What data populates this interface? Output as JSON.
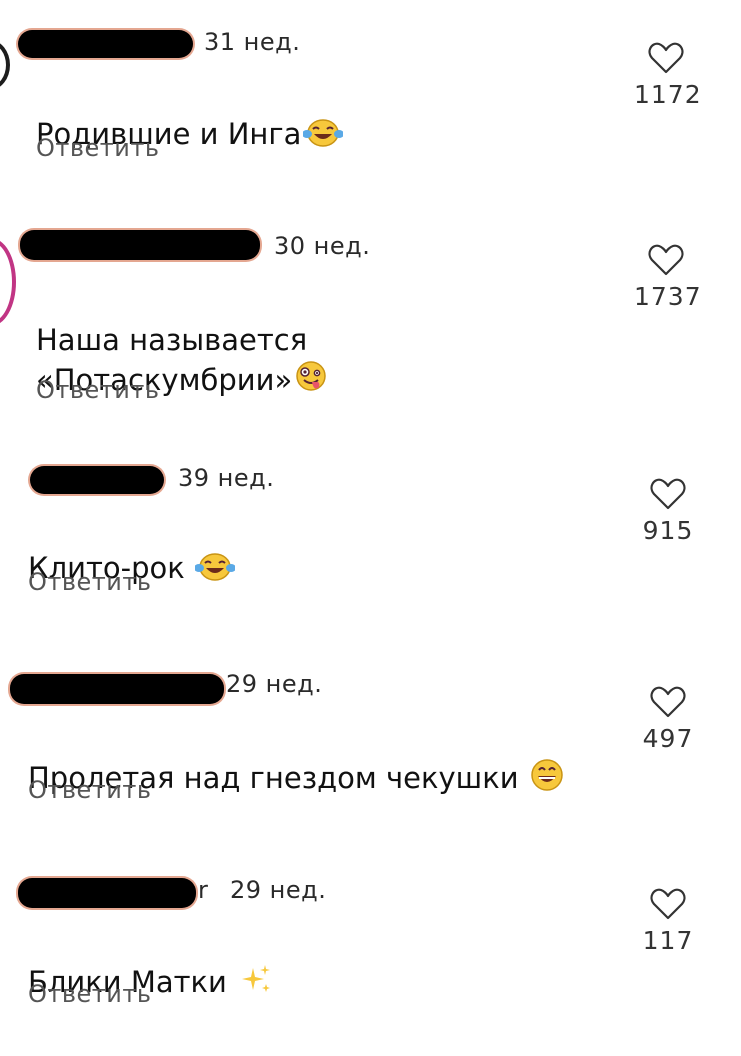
{
  "comments": [
    {
      "time": "31 нед.",
      "text": "Родившие и Инга",
      "emoji": "tears-of-joy-emoji",
      "reply": "Ответить",
      "likes": "1172"
    },
    {
      "time": "30 нед.",
      "text": "Наша называется\n«Потаскумбрии»",
      "emoji": "zany-face-emoji",
      "reply": "Ответить",
      "likes": "1737"
    },
    {
      "time": "39 нед.",
      "text": "Клито-рок",
      "emoji": "tears-of-joy-emoji",
      "reply": "Ответить",
      "likes": "915"
    },
    {
      "time": "29 нед.",
      "text": "Пролетая над гнездом чекушки",
      "emoji": "grinning-face-emoji",
      "reply": "Ответить",
      "likes": "497"
    },
    {
      "username_partial": "r",
      "time": "29 нед.",
      "text": "Блики Матки",
      "emoji": "sparkles-emoji",
      "reply": "Ответить",
      "likes": "117"
    }
  ],
  "colors": {
    "redaction": "#000000",
    "avatar_ring_gradient": "#c13584",
    "text": "#111111",
    "muted": "#555555"
  },
  "icons": {
    "like": "heart-outline-icon"
  }
}
